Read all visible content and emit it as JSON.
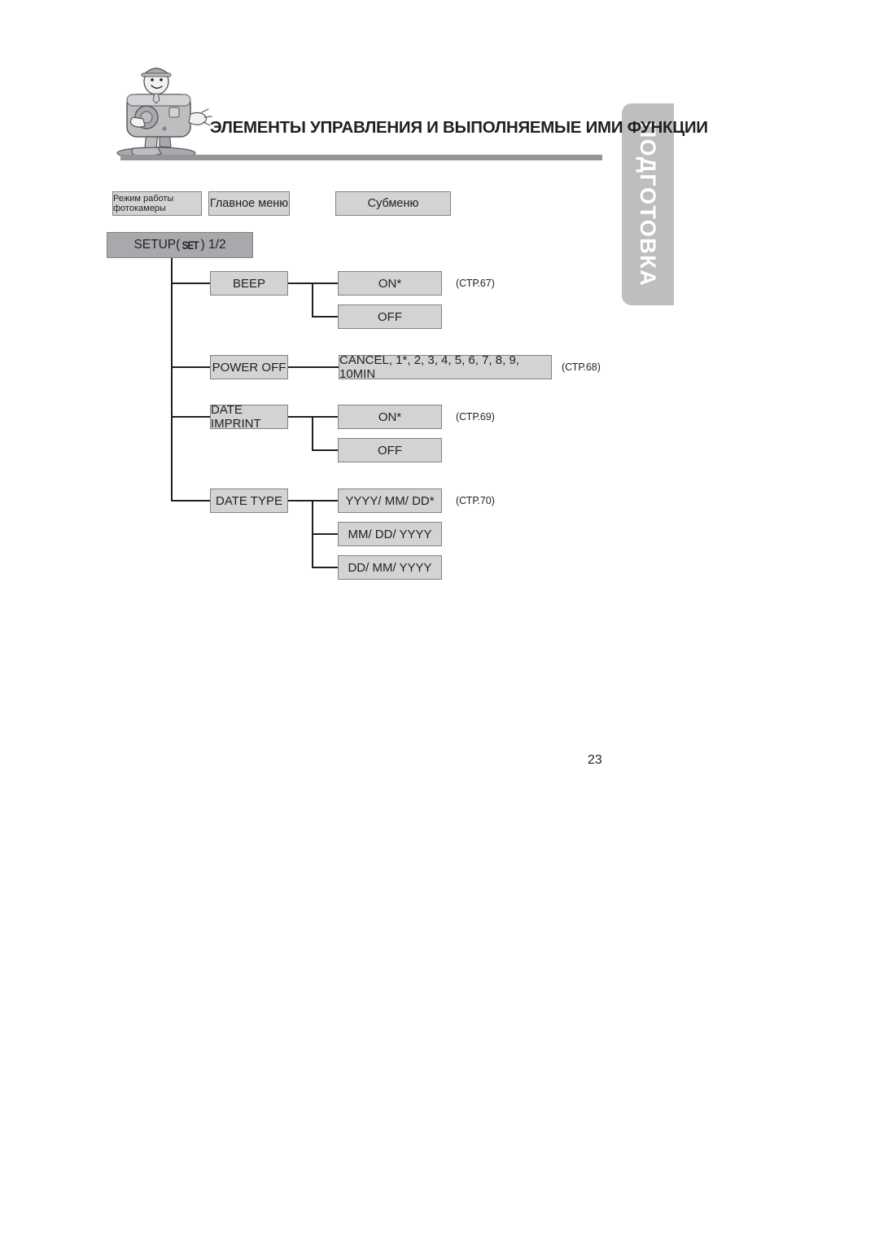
{
  "document": {
    "title": "ЭЛЕМЕНТЫ УПРАВЛЕНИЯ И ВЫПОЛНЯЕМЫЕ ИМИ ФУНКЦИИ",
    "page_number": "23",
    "side_tab_label": "ПОДГОТОВКА",
    "mascot_icon": "camera-mascot-icon"
  },
  "legend": {
    "camera_mode": "Режим работы фотокамеры",
    "main_menu": "Главное меню",
    "submenu": "Субменю"
  },
  "menu_tree": {
    "root": {
      "label_prefix": "SETUP(",
      "set_glyph": "SET",
      "label_suffix": ") 1/2"
    },
    "items": [
      {
        "name": "BEEP",
        "page_ref": "(СТР.67)",
        "options": [
          "ON*",
          "OFF"
        ]
      },
      {
        "name": "POWER OFF",
        "page_ref": "(СТР.68)",
        "options": [
          "CANCEL, 1*, 2, 3, 4, 5, 6, 7, 8, 9, 10MIN"
        ]
      },
      {
        "name": "DATE IMPRINT",
        "page_ref": "(СТР.69)",
        "options": [
          "ON*",
          "OFF"
        ]
      },
      {
        "name": "DATE TYPE",
        "page_ref": "(СТР.70)",
        "options": [
          "YYYY/ MM/ DD*",
          "MM/ DD/ YYYY",
          "DD/ MM/ YYYY"
        ]
      }
    ]
  },
  "colors": {
    "tab_gray": "#bcbec0",
    "box_light": "#d1d3d4",
    "box_dark": "#a7a9ac",
    "border": "#808285",
    "rule": "#939598",
    "text": "#231f20"
  }
}
